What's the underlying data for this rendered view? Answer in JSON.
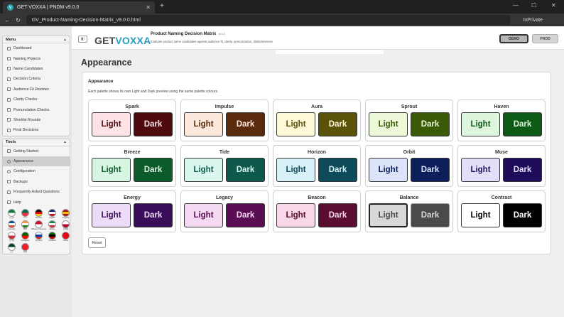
{
  "browser": {
    "tab_title": "GET VOXXA | PNDM v9.0.0",
    "tab_favicon": "V",
    "close_glyph": "✕",
    "new_tab_glyph": "+",
    "url": "GV_Product-Naming-Decision-Matrix_v9.0.0.html",
    "inprivate": "InPrivate",
    "back_glyph": "←",
    "reload_glyph": "↻",
    "min_glyph": "—",
    "max_glyph": "☐",
    "win_close_glyph": "✕"
  },
  "sidebar": {
    "menu_title": "Menu",
    "menu_items": [
      {
        "label": "Dashboard"
      },
      {
        "label": "Naming Projects"
      },
      {
        "label": "Name Candidates"
      },
      {
        "label": "Decision Criteria"
      },
      {
        "label": "Audience Fit Reviews"
      },
      {
        "label": "Clarity Checks"
      },
      {
        "label": "Pronunciation Checks"
      },
      {
        "label": "Shortlist Rounds"
      },
      {
        "label": "Final Decisions"
      }
    ],
    "tools_title": "Tools",
    "tools_items": [
      {
        "label": "Getting Started"
      },
      {
        "label": "Appearance"
      },
      {
        "label": "Configuration"
      },
      {
        "label": "Backups"
      },
      {
        "label": "Frequently Asked Questions"
      },
      {
        "label": "Help"
      }
    ],
    "flags": [
      {
        "label": "العربية",
        "colors": [
          "#0a7a3a",
          "#ffffff"
        ]
      },
      {
        "label": "বাংলা",
        "colors": [
          "#006a4e",
          "#f42a41"
        ]
      },
      {
        "label": "Deutsch",
        "colors": [
          "#000000",
          "#dd0000",
          "#ffce00"
        ]
      },
      {
        "label": "English",
        "colors": [
          "#012169",
          "#ffffff",
          "#c8102e"
        ]
      },
      {
        "label": "Español",
        "colors": [
          "#aa151b",
          "#f1bf00",
          "#aa151b"
        ]
      },
      {
        "label": "Français",
        "colors": [
          "#0055a4",
          "#ffffff",
          "#ef4135"
        ]
      },
      {
        "label": "हिन्दी",
        "colors": [
          "#ff9933",
          "#ffffff",
          "#138808"
        ]
      },
      {
        "label": "Bahasa Indonesia",
        "colors": [
          "#ce1126",
          "#ffffff"
        ]
      },
      {
        "label": "Italiano",
        "colors": [
          "#009246",
          "#ffffff",
          "#ce2b37"
        ]
      },
      {
        "label": "日本語",
        "colors": [
          "#ffffff",
          "#bc002d"
        ]
      },
      {
        "label": "한국어",
        "colors": [
          "#ffffff",
          "#cd2e3a"
        ]
      },
      {
        "label": "Português",
        "colors": [
          "#006600",
          "#ff0000"
        ]
      },
      {
        "label": "Русский",
        "colors": [
          "#ffffff",
          "#0039a6",
          "#d52b1e"
        ]
      },
      {
        "label": "Kiswahili",
        "colors": [
          "#006600",
          "#000000",
          "#bb0000"
        ]
      },
      {
        "label": "Türkçe",
        "colors": [
          "#e30a17",
          "#e30a17"
        ]
      },
      {
        "label": "اردو",
        "colors": [
          "#01411c",
          "#ffffff"
        ]
      },
      {
        "label": "中文",
        "colors": [
          "#ee1c25",
          "#ee1c25"
        ]
      }
    ]
  },
  "header": {
    "logo_get": "GET",
    "logo_voxxa": "VOXXA",
    "app_title": "Product Naming Decision Matrix",
    "app_version": "v9.0.0",
    "app_subtitle": "Evaluate product name candidates against audience fit, clarity, pronunciation, distinctiveness",
    "toggle_glyph": "◧",
    "demo_label": "DEMO",
    "prod_label": "PROD"
  },
  "page": {
    "title": "Appearance",
    "card_title": "Appearance",
    "description": "Each palette shows its own Light and Dark preview using the same palette colours.",
    "light_label": "Light",
    "dark_label": "Dark",
    "reset_label": "Reset"
  },
  "palettes": [
    {
      "name": "Spark",
      "light_bg": "#fde3e6",
      "light_fg": "#4f0a0d",
      "dark_bg": "#4f0a0d",
      "dark_fg": "#fde3e6"
    },
    {
      "name": "Impulse",
      "light_bg": "#fde8dc",
      "light_fg": "#5a2a0d",
      "dark_bg": "#5a2a0d",
      "dark_fg": "#fde8dc"
    },
    {
      "name": "Aura",
      "light_bg": "#fdf8d8",
      "light_fg": "#5a5208",
      "dark_bg": "#5a5208",
      "dark_fg": "#fdf8d8"
    },
    {
      "name": "Sprout",
      "light_bg": "#edf8d8",
      "light_fg": "#3a5a08",
      "dark_bg": "#3a5a08",
      "dark_fg": "#edf8d8"
    },
    {
      "name": "Haven",
      "light_bg": "#ddf5dd",
      "light_fg": "#0d5a16",
      "dark_bg": "#0d5a16",
      "dark_fg": "#ddf5dd"
    },
    {
      "name": "Breeze",
      "light_bg": "#d8f5e3",
      "light_fg": "#0d5a2a",
      "dark_bg": "#0d5a2a",
      "dark_fg": "#d8f5e3"
    },
    {
      "name": "Tide",
      "light_bg": "#d8f5ee",
      "light_fg": "#0d5a4c",
      "dark_bg": "#0d5a4c",
      "dark_fg": "#d8f5ee"
    },
    {
      "name": "Horizon",
      "light_bg": "#d8f0f7",
      "light_fg": "#0d4a5a",
      "dark_bg": "#0d4a5a",
      "dark_fg": "#d8f0f7"
    },
    {
      "name": "Orbit",
      "light_bg": "#dbe4f8",
      "light_fg": "#0d1f5a",
      "dark_bg": "#0d1f5a",
      "dark_fg": "#dbe4f8"
    },
    {
      "name": "Muse",
      "light_bg": "#e3def8",
      "light_fg": "#1f0d5a",
      "dark_bg": "#1f0d5a",
      "dark_fg": "#e3def8"
    },
    {
      "name": "Energy",
      "light_bg": "#eddcf8",
      "light_fg": "#3a0d5a",
      "dark_bg": "#3a0d5a",
      "dark_fg": "#eddcf8"
    },
    {
      "name": "Legacy",
      "light_bg": "#f5d8f2",
      "light_fg": "#5a0d52",
      "dark_bg": "#5a0d52",
      "dark_fg": "#f5d8f2"
    },
    {
      "name": "Beacon",
      "light_bg": "#f8d8e8",
      "light_fg": "#5a0d2f",
      "dark_bg": "#5a0d2f",
      "dark_fg": "#f8d8e8"
    },
    {
      "name": "Balance",
      "light_bg": "#d8d8d8",
      "light_fg": "#4a4a4a",
      "dark_bg": "#4a4a4a",
      "dark_fg": "#d8d8d8"
    },
    {
      "name": "Contrast",
      "light_bg": "#ffffff",
      "light_fg": "#000000",
      "dark_bg": "#000000",
      "dark_fg": "#ffffff"
    }
  ],
  "colors": {
    "accent": "#2a9fbd",
    "active_item": "#cfcfcf"
  }
}
